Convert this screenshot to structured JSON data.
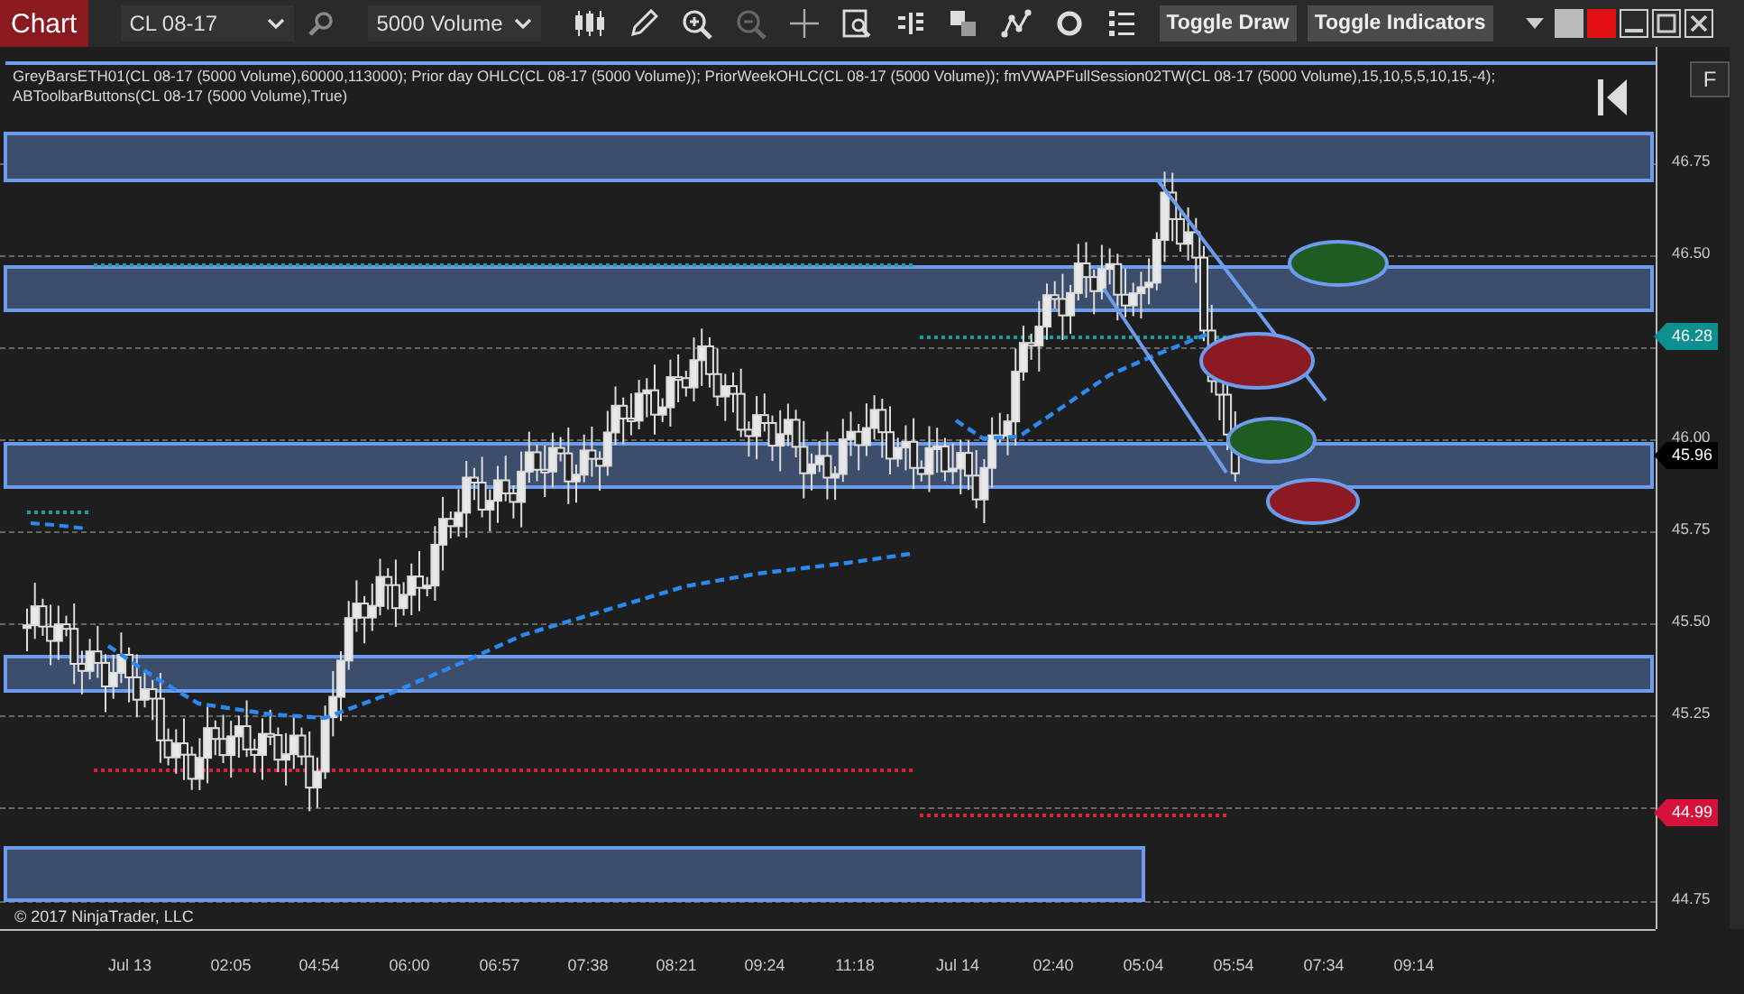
{
  "toolbar": {
    "chart_button": "Chart",
    "instrument": "CL 08-17",
    "bar_type": "5000 Volume",
    "buttons": [
      "Toggle Draw",
      "Toggle Indicators"
    ]
  },
  "indicator_label": "GreyBarsETH01(CL 08-17 (5000 Volume),60000,113000); Prior day OHLC(CL 08-17 (5000 Volume)); PriorWeekOHLC(CL 08-17 (5000 Volume)); fmVWAPFullSession02TW(CL 08-17 (5000 Volume),15,10,5,5,10,15,-4); ABToolbarButtons(CL 08-17 (5000 Volume),True)",
  "side_button": "F",
  "copyright": "© 2017 NinjaTrader, LLC",
  "price_axis": [
    "46.75",
    "46.50",
    "46.00",
    "45.75",
    "45.50",
    "45.25",
    "44.75"
  ],
  "price_markers": [
    {
      "label": "46.28",
      "color": "#0e8f8f"
    },
    {
      "label": "45.96",
      "color": "#000000"
    },
    {
      "label": "44.99",
      "color": "#d4123c"
    }
  ],
  "time_axis": [
    "Jul 13",
    "02:05",
    "04:54",
    "06:00",
    "06:57",
    "07:38",
    "08:21",
    "09:24",
    "11:18",
    "Jul 14",
    "02:40",
    "05:04",
    "05:54",
    "07:34",
    "09:14"
  ]
}
